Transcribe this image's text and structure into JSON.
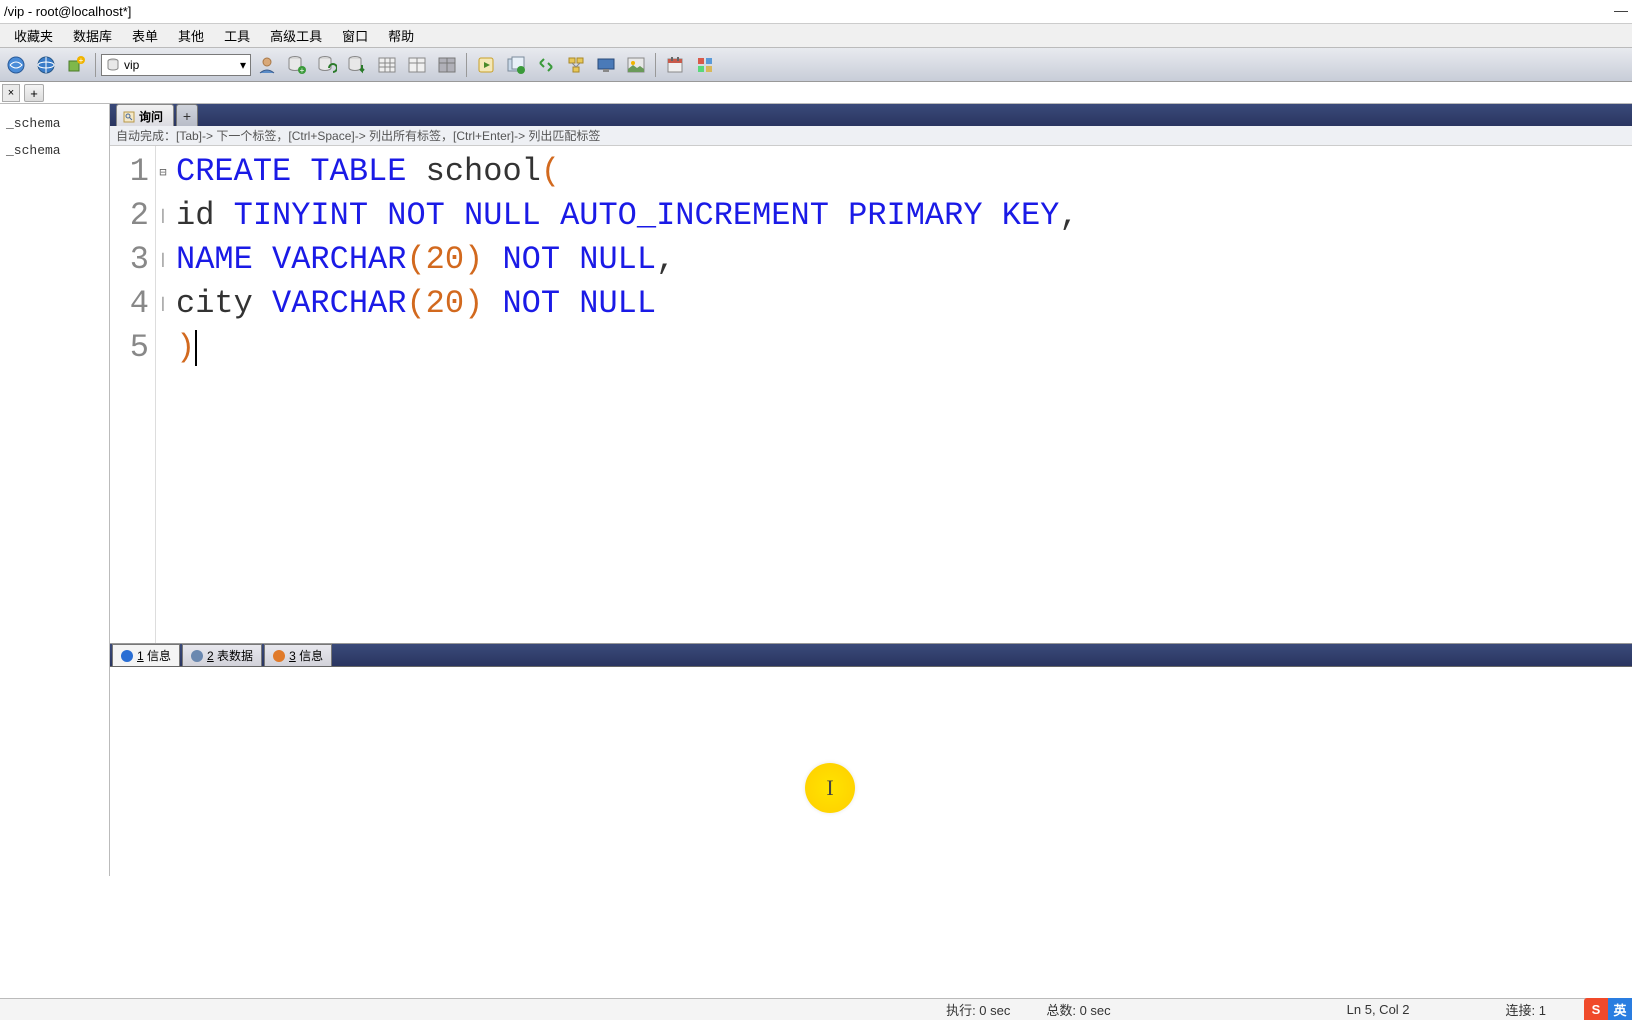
{
  "window": {
    "title": "/vip - root@localhost*]"
  },
  "menu": [
    "收藏夹",
    "数据库",
    "表单",
    "其他",
    "工具",
    "高级工具",
    "窗口",
    "帮助"
  ],
  "toolbar": {
    "selected_db": "vip"
  },
  "sidebar": {
    "items": [
      "_schema",
      "_schema"
    ]
  },
  "query_tab": {
    "label": "询问"
  },
  "hint": "自动完成：[Tab]-> 下一个标签，[Ctrl+Space]-> 列出所有标签，[Ctrl+Enter]-> 列出匹配标签",
  "code": {
    "lines": [
      {
        "n": "1",
        "tokens": [
          [
            "kw",
            "CREATE"
          ],
          [
            "sp",
            " "
          ],
          [
            "kw",
            "TABLE"
          ],
          [
            "sp",
            " "
          ],
          [
            "ident",
            "school"
          ],
          [
            "paren",
            "("
          ]
        ]
      },
      {
        "n": "2",
        "tokens": [
          [
            "ident",
            "id"
          ],
          [
            "sp",
            " "
          ],
          [
            "kw",
            "TINYINT"
          ],
          [
            "sp",
            " "
          ],
          [
            "kw",
            "NOT"
          ],
          [
            "sp",
            " "
          ],
          [
            "kw",
            "NULL"
          ],
          [
            "sp",
            " "
          ],
          [
            "kw",
            "AUTO_INCREMENT"
          ],
          [
            "sp",
            " "
          ],
          [
            "kw",
            "PRIMARY"
          ],
          [
            "sp",
            " "
          ],
          [
            "kw",
            "KEY"
          ],
          [
            "ident",
            ","
          ]
        ]
      },
      {
        "n": "3",
        "tokens": [
          [
            "kw",
            "NAME"
          ],
          [
            "sp",
            " "
          ],
          [
            "kw",
            "VARCHAR"
          ],
          [
            "paren",
            "("
          ],
          [
            "num",
            "20"
          ],
          [
            "paren",
            ")"
          ],
          [
            "sp",
            " "
          ],
          [
            "kw",
            "NOT"
          ],
          [
            "sp",
            " "
          ],
          [
            "kw",
            "NULL"
          ],
          [
            "ident",
            ","
          ]
        ]
      },
      {
        "n": "4",
        "tokens": [
          [
            "ident",
            "city"
          ],
          [
            "sp",
            " "
          ],
          [
            "kw",
            "VARCHAR"
          ],
          [
            "paren",
            "("
          ],
          [
            "num",
            "20"
          ],
          [
            "paren",
            ")"
          ],
          [
            "sp",
            " "
          ],
          [
            "kw",
            "NOT"
          ],
          [
            "sp",
            " "
          ],
          [
            "kw",
            "NULL"
          ]
        ]
      },
      {
        "n": "5",
        "tokens": [
          [
            "paren",
            ")"
          ]
        ],
        "cursor": true
      }
    ]
  },
  "result_tabs": [
    {
      "label": "1 信息",
      "icon_color": "#2a6ed4"
    },
    {
      "label": "2 表数据",
      "icon_color": "#6a88b0"
    },
    {
      "label": "3 信息",
      "icon_color": "#e07a2a"
    }
  ],
  "status": {
    "exec": "执行: 0 sec",
    "total": "总数: 0 sec",
    "position": "Ln 5, Col 2",
    "connection": "连接: 1"
  },
  "ime": {
    "s": "S",
    "lang": "英"
  }
}
